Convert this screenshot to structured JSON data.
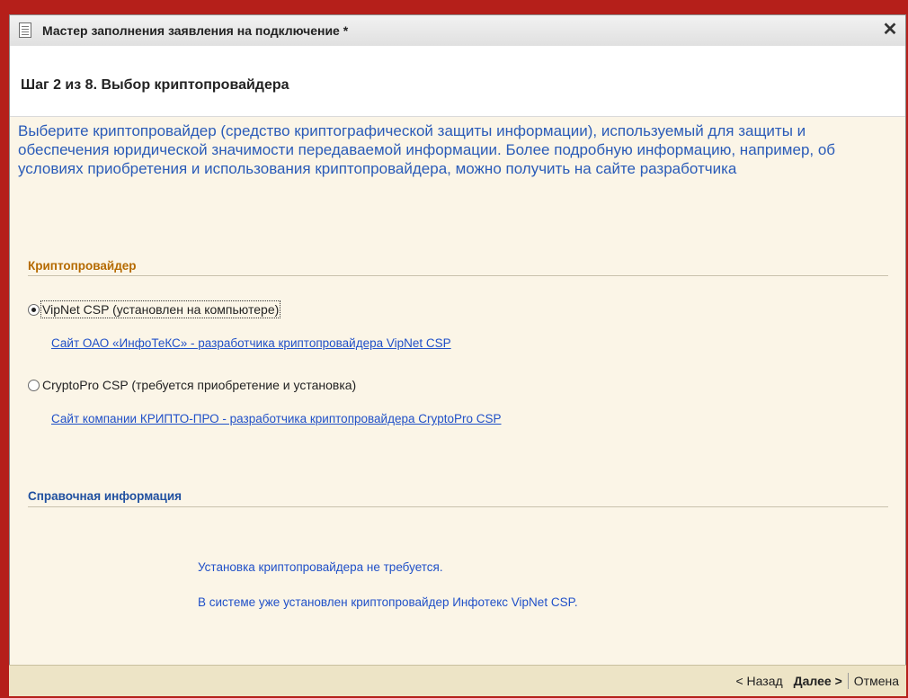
{
  "window": {
    "title": "Мастер заполнения заявления на подключение *",
    "close_label": "✕"
  },
  "header": {
    "step_title": "Шаг 2 из 8. Выбор криптопровайдера"
  },
  "description": "Выберите криптопровайдер (средство криптографической защиты информации), используемый для защиты и обеспечения юридической значимости передаваемой информации. Более подробную информацию, например, об условиях приобретения и использования криптопровайдера, можно получить на сайте разработчика",
  "crypto_group": {
    "title": "Криптопровайдер",
    "title_color": "#b56a00",
    "options": [
      {
        "label": "VipNet CSP (установлен на компьютере)",
        "checked": true,
        "link": "Сайт ОАО «ИнфоТеКС» - разработчика криптопровайдера VipNet CSP"
      },
      {
        "label": "CryptoPro CSP (требуется приобретение и установка)",
        "checked": false,
        "link": "Сайт компании КРИПТО-ПРО - разработчика криптопровайдера  CryptoPro CSP"
      }
    ]
  },
  "info_group": {
    "title": "Справочная информация",
    "title_color": "#2050a0",
    "line1": "Установка криптопровайдера не требуется.",
    "line2": "В системе уже установлен криптопровайдер Инфотекс VipNet CSP."
  },
  "footer": {
    "back_label": "< Назад",
    "next_label": "Далее >",
    "cancel_label": "Отмена"
  },
  "colors": {
    "accent_blue": "#2a5bb8",
    "link_blue": "#2050c8",
    "background": "#fbf5e7",
    "footer_bg": "#ede4c6",
    "outer_frame": "#b51f1a"
  }
}
